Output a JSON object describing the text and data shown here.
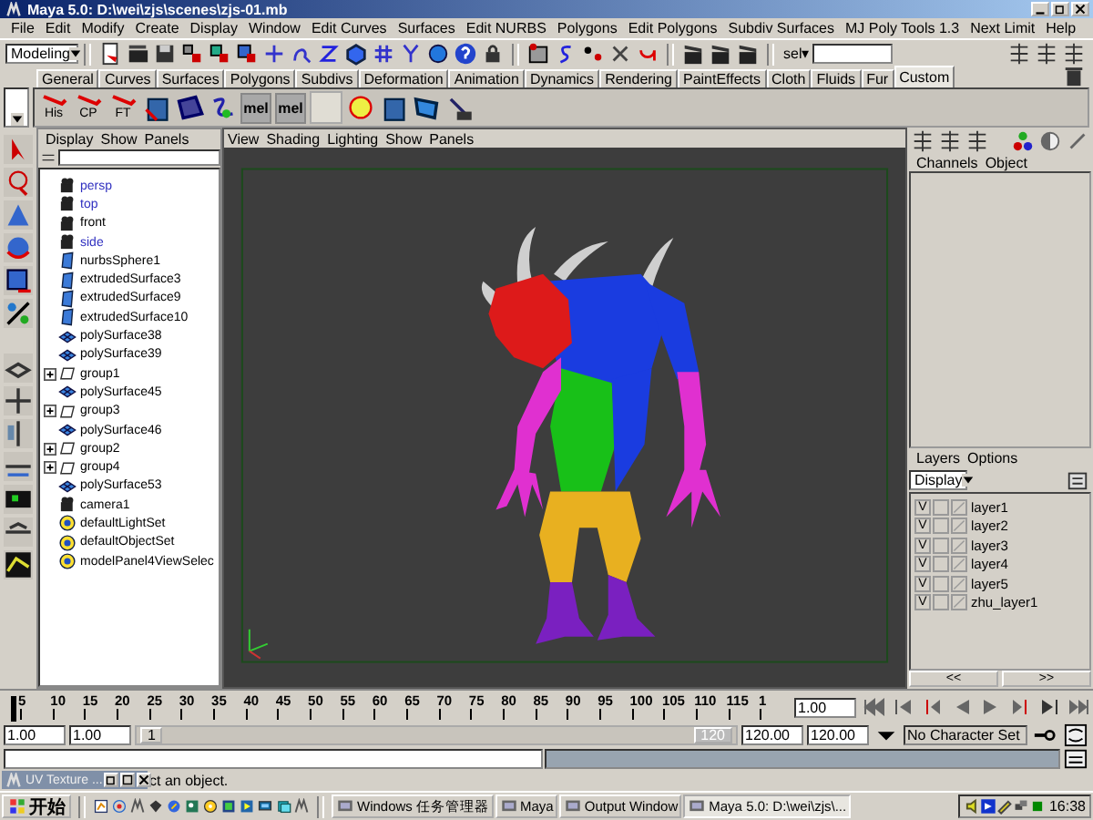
{
  "window": {
    "title": "Maya 5.0: D:\\wei\\zjs\\scenes\\zjs-01.mb"
  },
  "menu_bar": [
    "File",
    "Edit",
    "Modify",
    "Create",
    "Display",
    "Window",
    "Edit Curves",
    "Surfaces",
    "Edit NURBS",
    "Polygons",
    "Edit Polygons",
    "Subdiv Surfaces",
    "MJ Poly Tools 1.3",
    "Next Limit",
    "Help"
  ],
  "status_line": {
    "mode": "Modeling",
    "selection_label": "sel▾"
  },
  "shelf_tabs": [
    {
      "label": "General",
      "selected": false
    },
    {
      "label": "Curves",
      "selected": false
    },
    {
      "label": "Surfaces",
      "selected": false
    },
    {
      "label": "Polygons",
      "selected": false
    },
    {
      "label": "Subdivs",
      "selected": false
    },
    {
      "label": "Deformation",
      "selected": false
    },
    {
      "label": "Animation",
      "selected": false
    },
    {
      "label": "Dynamics",
      "selected": false
    },
    {
      "label": "Rendering",
      "selected": false
    },
    {
      "label": "PaintEffects",
      "selected": false
    },
    {
      "label": "Cloth",
      "selected": false
    },
    {
      "label": "Fluids",
      "selected": false
    },
    {
      "label": "Fur",
      "selected": false
    },
    {
      "label": "Custom",
      "selected": true
    }
  ],
  "shelf": {
    "labeled_buttons": [
      "His",
      "CP",
      "FT"
    ],
    "mel_buttons": [
      "mel",
      "mel"
    ]
  },
  "outliner": {
    "menu": [
      "Display",
      "Show",
      "Panels"
    ],
    "items": [
      {
        "label": "persp",
        "kind": "camera",
        "color": "#3030c0"
      },
      {
        "label": "top",
        "kind": "camera",
        "color": "#3030c0"
      },
      {
        "label": "front",
        "kind": "camera",
        "color": "#000000"
      },
      {
        "label": "side",
        "kind": "camera",
        "color": "#3030c0"
      },
      {
        "label": "nurbsSphere1",
        "kind": "nurbs",
        "color": "#000000"
      },
      {
        "label": "extrudedSurface3",
        "kind": "nurbs",
        "color": "#000000"
      },
      {
        "label": "extrudedSurface9",
        "kind": "nurbs",
        "color": "#000000"
      },
      {
        "label": "extrudedSurface10",
        "kind": "nurbs",
        "color": "#000000"
      },
      {
        "label": "polySurface38",
        "kind": "poly",
        "color": "#000000"
      },
      {
        "label": "polySurface39",
        "kind": "poly",
        "color": "#000000"
      },
      {
        "label": "group1",
        "kind": "group",
        "color": "#000000"
      },
      {
        "label": "polySurface45",
        "kind": "poly",
        "color": "#000000"
      },
      {
        "label": "group3",
        "kind": "group",
        "color": "#000000"
      },
      {
        "label": "polySurface46",
        "kind": "poly",
        "color": "#000000"
      },
      {
        "label": "group2",
        "kind": "group",
        "color": "#000000"
      },
      {
        "label": "group4",
        "kind": "group",
        "color": "#000000"
      },
      {
        "label": "polySurface53",
        "kind": "poly",
        "color": "#000000"
      },
      {
        "label": "camera1",
        "kind": "camera",
        "color": "#000000"
      },
      {
        "label": "defaultLightSet",
        "kind": "set",
        "color": "#000000"
      },
      {
        "label": "defaultObjectSet",
        "kind": "set",
        "color": "#000000"
      },
      {
        "label": "modelPanel4ViewSelec",
        "kind": "set",
        "color": "#000000"
      }
    ]
  },
  "viewport": {
    "menu": [
      "View",
      "Shading",
      "Lighting",
      "Show",
      "Panels"
    ]
  },
  "channel_box": {
    "menu": [
      "Channels",
      "Object"
    ]
  },
  "layers": {
    "menu": [
      "Layers",
      "Options"
    ],
    "mode": "Display",
    "items": [
      {
        "visibility": "V",
        "name": "layer1"
      },
      {
        "visibility": "V",
        "name": "layer2"
      },
      {
        "visibility": "V",
        "name": "layer3"
      },
      {
        "visibility": "V",
        "name": "layer4"
      },
      {
        "visibility": "V",
        "name": "layer5"
      },
      {
        "visibility": "V",
        "name": "zhu_layer1"
      }
    ],
    "nav_buttons": [
      "<<",
      ">>"
    ]
  },
  "timeline": {
    "ticks": [
      "5",
      "10",
      "15",
      "20",
      "25",
      "30",
      "35",
      "40",
      "45",
      "50",
      "55",
      "60",
      "65",
      "70",
      "75",
      "80",
      "85",
      "90",
      "95",
      "100",
      "105",
      "110",
      "115",
      "1"
    ],
    "current_frame": "1.00",
    "level": 0
  },
  "range": {
    "level": 1,
    "start": "1.00",
    "playback_start": "1.00",
    "thumb_start": "1",
    "thumb_end": "120",
    "playback_end": "120.00",
    "end": "120.00",
    "character_set": "No Character Set"
  },
  "help_line": {
    "text": "ct an object."
  },
  "minimized_window": {
    "title": "UV Texture ..."
  },
  "taskbar": {
    "start": "开始",
    "tasks": [
      {
        "label": "Windows 任务管理器",
        "selected": false
      },
      {
        "label": "Maya",
        "selected": false
      },
      {
        "label": "Output Window",
        "selected": false
      },
      {
        "label": "Maya 5.0: D:\\wei\\zjs\\...",
        "selected": true
      }
    ],
    "clock": "16:38"
  }
}
